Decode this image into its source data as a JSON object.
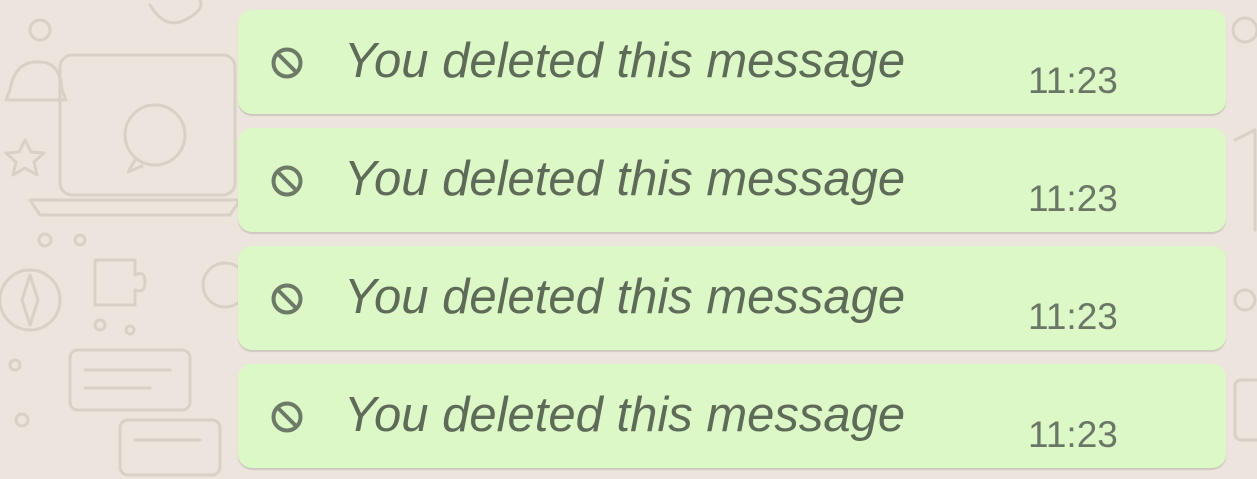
{
  "chat": {
    "messages": [
      {
        "text": "You deleted this message",
        "time": "11:23",
        "icon": "ban-icon"
      },
      {
        "text": "You deleted this message",
        "time": "11:23",
        "icon": "ban-icon"
      },
      {
        "text": "You deleted this message",
        "time": "11:23",
        "icon": "ban-icon"
      },
      {
        "text": "You deleted this message",
        "time": "11:23",
        "icon": "ban-icon"
      }
    ]
  },
  "colors": {
    "background": "#ece5dd",
    "bubble": "#dcf8c6",
    "text": "#5f6b59",
    "time": "#6b7766"
  }
}
